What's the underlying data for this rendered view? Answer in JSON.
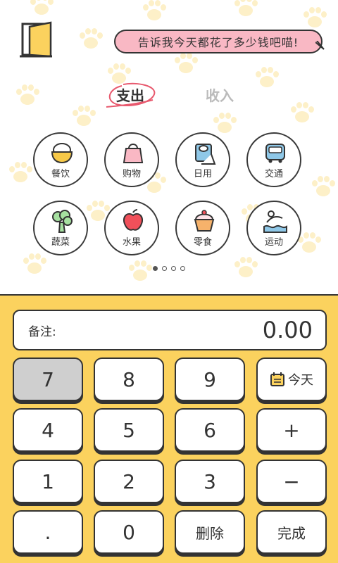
{
  "header": {
    "speech_text": "告诉我今天都花了多少钱吧喵!"
  },
  "tabs": [
    {
      "label": "支出",
      "active": true
    },
    {
      "label": "收入",
      "active": false
    }
  ],
  "categories": [
    {
      "label": "餐饮",
      "icon": "rice-bowl-icon"
    },
    {
      "label": "购物",
      "icon": "shopping-bag-icon"
    },
    {
      "label": "日用",
      "icon": "toilet-paper-icon"
    },
    {
      "label": "交通",
      "icon": "bus-icon"
    },
    {
      "label": "蔬菜",
      "icon": "broccoli-icon"
    },
    {
      "label": "水果",
      "icon": "apple-icon"
    },
    {
      "label": "零食",
      "icon": "cupcake-icon"
    },
    {
      "label": "运动",
      "icon": "swimming-icon"
    }
  ],
  "pager": {
    "pages": 4,
    "current": 1
  },
  "display": {
    "note_label": "备注:",
    "amount": "0.00"
  },
  "keypad": {
    "k7": "7",
    "k8": "8",
    "k9": "9",
    "today": "今天",
    "k4": "4",
    "k5": "5",
    "k6": "6",
    "plus": "+",
    "k1": "1",
    "k2": "2",
    "k3": "3",
    "minus": "−",
    "dot": ".",
    "k0": "0",
    "delete": "删除",
    "done": "完成"
  },
  "colors": {
    "panel": "#fbd25e",
    "speech_bubble": "#f9b8c4",
    "paw": "#fdf0c8",
    "pressed_key": "#cfcfcf"
  }
}
